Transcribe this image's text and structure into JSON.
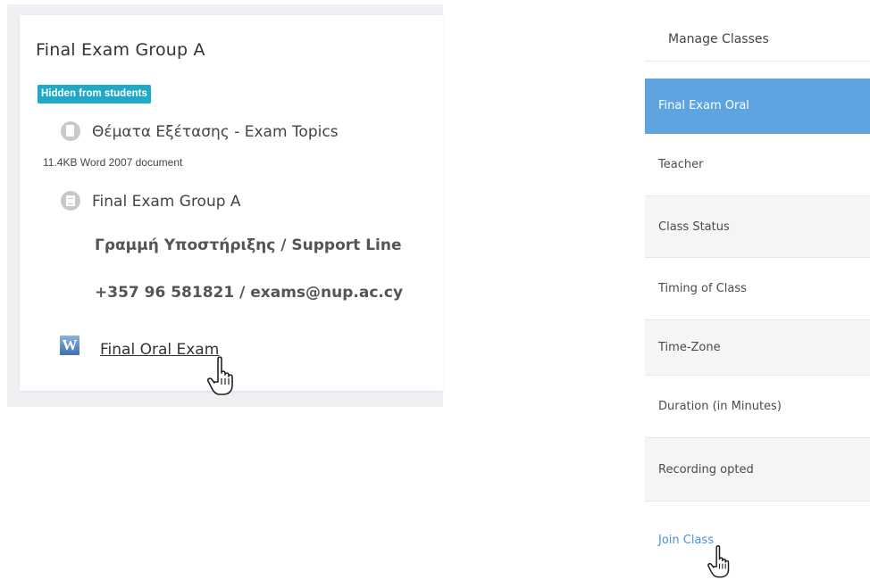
{
  "left_card": {
    "section_title": "Final Exam Group A",
    "badge": "Hidden from students",
    "activities": [
      {
        "icon": "document-icon",
        "name": "Θέματα Εξέτασης - Exam Topics",
        "meta": "11.4KB Word 2007 document"
      },
      {
        "icon": "page-icon",
        "name": "Final Exam Group A"
      }
    ],
    "support_line": "Γραμμή Υποστήριξης / Support Line",
    "support_contact": "+357 96 581821 / exams@nup.ac.cy",
    "oral_exam_link": "Final Oral Exam",
    "oral_exam_icon": "word-icon"
  },
  "right_panel": {
    "header": "Manage Classes",
    "rows": [
      {
        "label": "Final Exam Oral"
      },
      {
        "label": "Teacher"
      },
      {
        "label": "Class Status"
      },
      {
        "label": "Timing of Class"
      },
      {
        "label": "Time-Zone"
      },
      {
        "label": "Duration (in Minutes)"
      },
      {
        "label": "Recording opted"
      },
      {
        "label": "Join Class"
      }
    ]
  },
  "colors": {
    "badge": "#20a9c6",
    "highlight_row": "#5da4e0",
    "link": "#4a90d9"
  }
}
